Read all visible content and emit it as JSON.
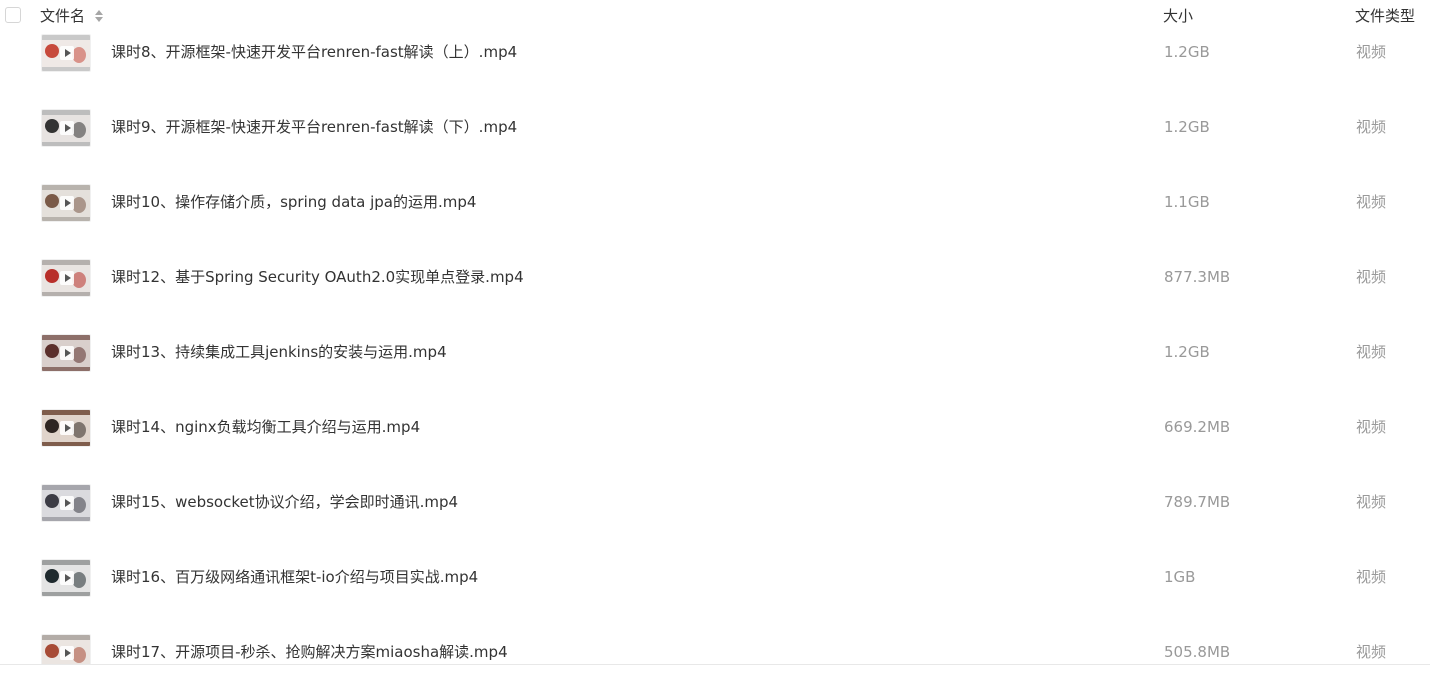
{
  "header": {
    "name_label": "文件名",
    "size_label": "大小",
    "type_label": "文件类型"
  },
  "files": [
    {
      "name": "课时8、开源框架-快速开发平台renren-fast解读（上）.mp4",
      "size": "1.2GB",
      "type": "视频",
      "icon": "video-thumbnail",
      "colors": [
        "#c9c9c9",
        "#efe9e6",
        "#c74a3c"
      ]
    },
    {
      "name": "课时9、开源框架-快速开发平台renren-fast解读（下）.mp4",
      "size": "1.2GB",
      "type": "视频",
      "icon": "video-thumbnail",
      "colors": [
        "#bdbdbd",
        "#e7e3e1",
        "#333333"
      ]
    },
    {
      "name": "课时10、操作存储介质，spring data jpa的运用.mp4",
      "size": "1.1GB",
      "type": "视频",
      "icon": "video-thumbnail",
      "colors": [
        "#b8b3ad",
        "#e4e0db",
        "#7a5a48"
      ]
    },
    {
      "name": "课时12、基于Spring Security OAuth2.0实现单点登录.mp4",
      "size": "877.3MB",
      "type": "视频",
      "icon": "video-thumbnail",
      "colors": [
        "#b5b0ad",
        "#e9e4e1",
        "#b82f2a"
      ]
    },
    {
      "name": "课时13、持续集成工具jenkins的安装与运用.mp4",
      "size": "1.2GB",
      "type": "视频",
      "icon": "video-thumbnail",
      "colors": [
        "#8d6f69",
        "#d9cfcc",
        "#5b2f2c"
      ]
    },
    {
      "name": "课时14、nginx负载均衡工具介绍与运用.mp4",
      "size": "669.2MB",
      "type": "视频",
      "icon": "video-thumbnail",
      "colors": [
        "#7f5d4c",
        "#e0d4cb",
        "#2f2622"
      ]
    },
    {
      "name": "课时15、websocket协议介绍，学会即时通讯.mp4",
      "size": "789.7MB",
      "type": "视频",
      "icon": "video-thumbnail",
      "colors": [
        "#a6a6ac",
        "#dadade",
        "#3c3c45"
      ]
    },
    {
      "name": "课时16、百万级网络通讯框架t-io介绍与项目实战.mp4",
      "size": "1GB",
      "type": "视频",
      "icon": "video-thumbnail",
      "colors": [
        "#9ea0a0",
        "#e4e4e4",
        "#1f2a2e"
      ]
    },
    {
      "name": "课时17、开源项目-秒杀、抢购解决方案miaosha解读.mp4",
      "size": "505.8MB",
      "type": "视频",
      "icon": "video-thumbnail",
      "colors": [
        "#b3aca7",
        "#ebe5e1",
        "#a74b36"
      ]
    }
  ]
}
